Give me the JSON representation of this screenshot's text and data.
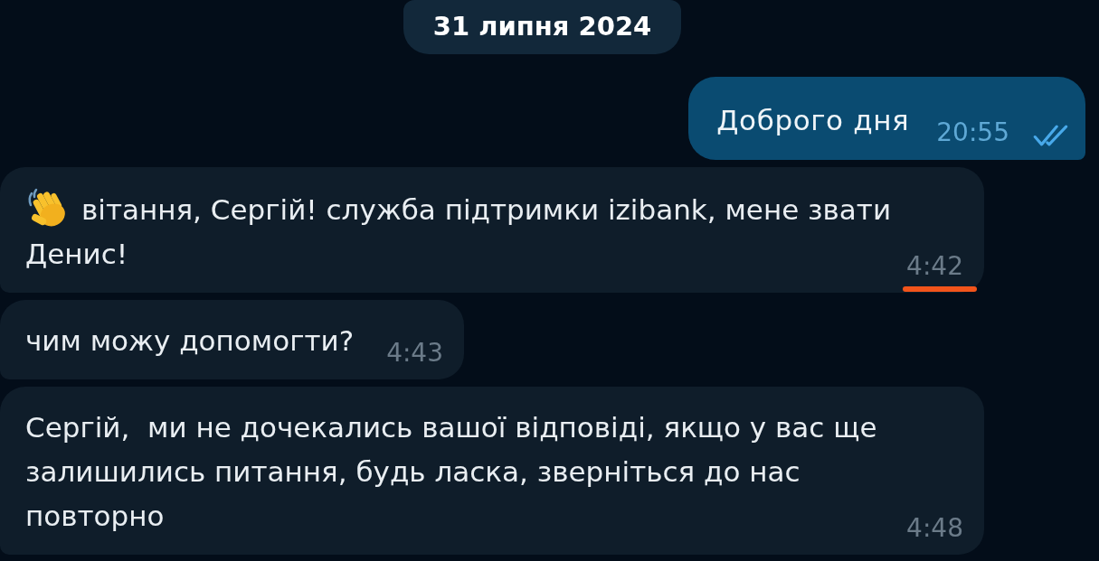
{
  "date_badge": "31 липня 2024",
  "messages": [
    {
      "kind": "outgoing",
      "text": "Доброго дня",
      "time": "20:55",
      "read": true
    },
    {
      "kind": "incoming",
      "text": "вітання, Сергій! служба підтримки izibank, мене звати Денис!",
      "time": "4:42",
      "emoji": true,
      "time_underlined": true
    },
    {
      "kind": "incoming",
      "text": "чим можу допомогти?",
      "time": "4:43",
      "emoji": false,
      "time_underlined": false
    },
    {
      "kind": "incoming",
      "text": "Сергій,  ми не дочекались вашої відповіді, якщо у вас ще залишились питання, будь ласка, зверніться до нас повторно",
      "time": "4:48",
      "emoji": false,
      "time_underlined": false
    }
  ]
}
